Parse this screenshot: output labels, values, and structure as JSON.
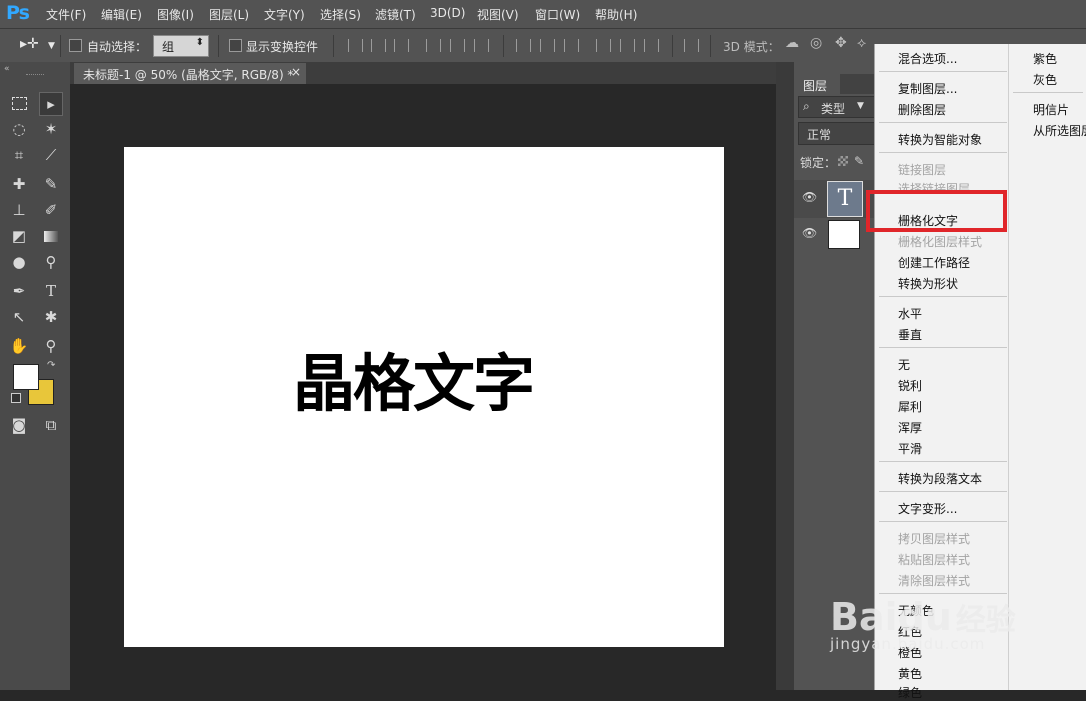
{
  "app": {
    "logo": "Ps"
  },
  "menubar": {
    "items": [
      "文件(F)",
      "编辑(E)",
      "图像(I)",
      "图层(L)",
      "文字(Y)",
      "选择(S)",
      "滤镜(T)",
      "3D(D)",
      "视图(V)",
      "窗口(W)",
      "帮助(H)"
    ]
  },
  "options_bar": {
    "auto_select_label": "自动选择：",
    "auto_select_value": "组",
    "show_transform_label": "显示变换控件",
    "mode_3d_label": "3D 模式："
  },
  "document": {
    "tab_title": "未标题-1 @ 50% (晶格文字, RGB/8) *",
    "close_glyph": "×",
    "canvas_text": "晶格文字"
  },
  "layers_panel": {
    "tab_label": "图层",
    "filter_label": "类型",
    "blend_mode": "正常",
    "lock_label": "锁定："
  },
  "context_menu": {
    "items": [
      {
        "label": "混合选项...",
        "enabled": true
      },
      {
        "label": "复制图层...",
        "enabled": true
      },
      {
        "label": "删除图层",
        "enabled": true
      },
      {
        "label": "转换为智能对象",
        "enabled": true
      },
      {
        "label": "链接图层",
        "enabled": false
      },
      {
        "label": "选择链接图层",
        "enabled": false
      },
      {
        "label": "栅格化文字",
        "enabled": true
      },
      {
        "label": "栅格化图层样式",
        "enabled": false
      },
      {
        "label": "创建工作路径",
        "enabled": true
      },
      {
        "label": "转换为形状",
        "enabled": true
      },
      {
        "label": "水平",
        "enabled": true
      },
      {
        "label": "垂直",
        "enabled": true
      },
      {
        "label": "无",
        "enabled": true
      },
      {
        "label": "锐利",
        "enabled": true
      },
      {
        "label": "犀利",
        "enabled": true
      },
      {
        "label": "浑厚",
        "enabled": true
      },
      {
        "label": "平滑",
        "enabled": true
      },
      {
        "label": "转换为段落文本",
        "enabled": true
      },
      {
        "label": "文字变形...",
        "enabled": true
      },
      {
        "label": "拷贝图层样式",
        "enabled": false
      },
      {
        "label": "粘贴图层样式",
        "enabled": false
      },
      {
        "label": "清除图层样式",
        "enabled": false
      },
      {
        "label": "无颜色",
        "enabled": true
      },
      {
        "label": "红色",
        "enabled": true
      },
      {
        "label": "橙色",
        "enabled": true
      },
      {
        "label": "黄色",
        "enabled": true
      },
      {
        "label": "绿色",
        "enabled": true
      }
    ],
    "highlighted": "栅格化文字",
    "highlight_color": "#e0262a"
  },
  "submenu": {
    "items": [
      "紫色",
      "灰色",
      "明信片",
      "从所选图层"
    ]
  },
  "watermark": {
    "brand": "Baidu",
    "suffix": "经验",
    "url": "jingyan.baidu.com"
  },
  "colors": {
    "foreground": "#ffffff",
    "background": "#e8c63a",
    "ps_blue": "#31a8ff",
    "menubar_bg": "#535353"
  }
}
